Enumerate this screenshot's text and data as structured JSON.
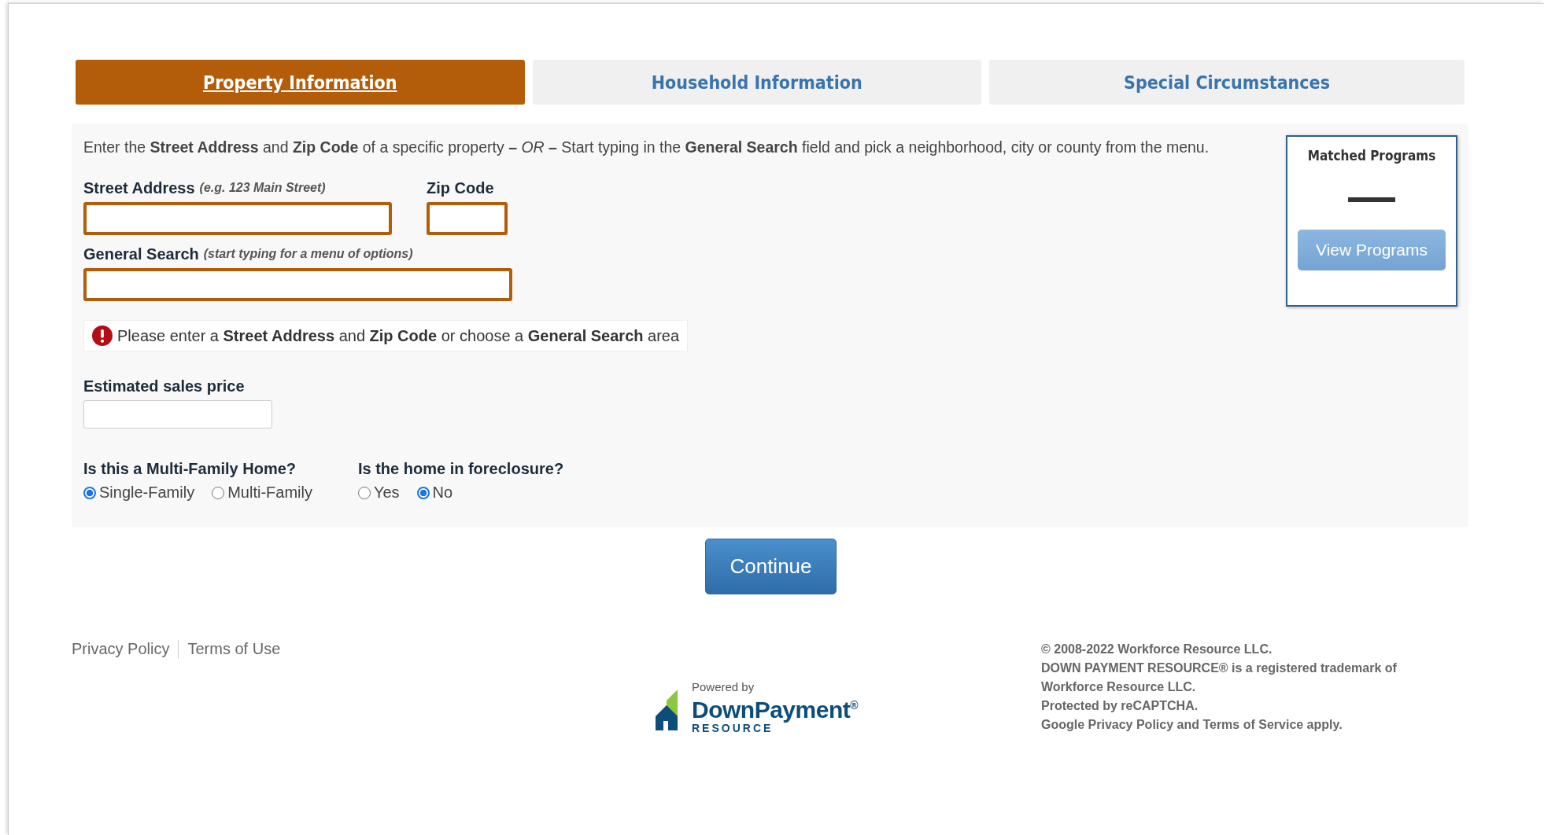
{
  "tabs": [
    {
      "label": "Property Information",
      "selected": true
    },
    {
      "label": "Household Information",
      "selected": false
    },
    {
      "label": "Special Circumstances",
      "selected": false
    }
  ],
  "intro": "Enter the **Street Address** and **Zip Code** of a specific property  **–** *OR* **–**  Start typing in the **General Search** field and pick a neighborhood, city or county from the menu.",
  "street_address": {
    "label": "Street Address",
    "hint": "(e.g. 123 Main Street)"
  },
  "zip_code": {
    "label": "Zip Code"
  },
  "general_search": {
    "label": "General Search",
    "hint": "(start typing for a menu of options)"
  },
  "error": "Please enter a **Street Address** and **Zip Code** or choose a **General Search** area",
  "sales_price": {
    "label": "Estimated sales price"
  },
  "questions": [
    {
      "label": "Is this a Multi-Family Home?",
      "options": [
        {
          "label": "Single-Family",
          "selected": true
        },
        {
          "label": "Multi-Family",
          "selected": false
        }
      ]
    },
    {
      "label": "Is the home in foreclosure?",
      "options": [
        {
          "label": "Yes",
          "selected": false
        },
        {
          "label": "No",
          "selected": true
        }
      ]
    }
  ],
  "matched_programs": {
    "title": "Matched Programs",
    "count": "—",
    "button": "View Programs"
  },
  "continue_button": "Continue",
  "footer": {
    "links": [
      "Privacy Policy",
      "Terms of Use"
    ],
    "logo": {
      "powered_by": "Powered by",
      "name": "DownPayment$^{®}$",
      "sub": "RESOURCE"
    },
    "legal": [
      "© 2008-2022 Workforce Resource LLC.",
      "DOWN PAYMENT RESOURCE® is a registered trademark of",
      "Workforce Resource LLC.",
      "Protected by reCAPTCHA.",
      "Google Privacy Policy and Terms of Service apply."
    ]
  }
}
